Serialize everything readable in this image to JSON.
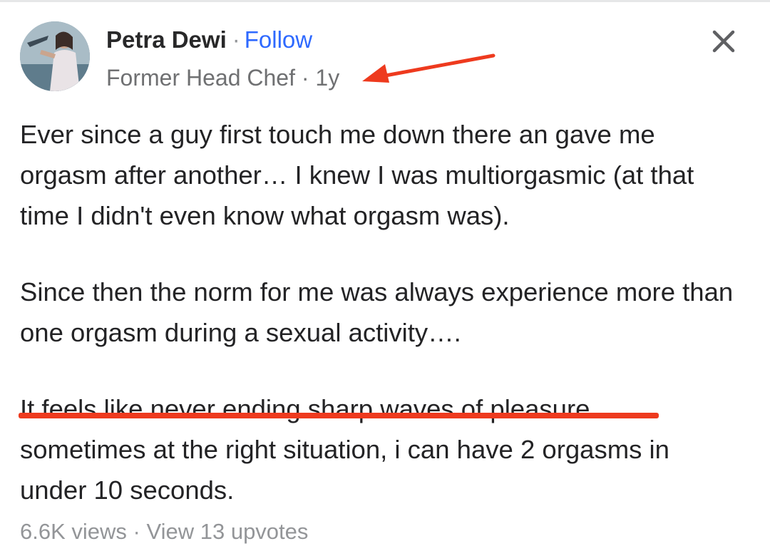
{
  "author": {
    "name": "Petra Dewi",
    "separator": "·",
    "follow_label": "Follow",
    "credential": "Former Head Chef",
    "meta_separator": "·",
    "timestamp": "1y"
  },
  "post": {
    "paragraphs": [
      "Ever since a guy first touch me down there an gave me orgasm after another… I knew I was multiorgasmic (at that time I didn't even know what orgasm was).",
      "Since then the norm for me was always experience more than one orgasm during a sexual activity….",
      "It feels like never ending sharp waves of pleasure… sometimes at the right situation, i can have 2 orgasms in under 10 seconds."
    ]
  },
  "stats": {
    "views": "6.6K views",
    "separator": "·",
    "upvotes_link": "View 13 upvotes"
  },
  "icons": {
    "close": "close-icon",
    "avatar": "avatar-photo"
  },
  "colors": {
    "link_blue": "#2e69ff",
    "annotation_red": "#ee3a1e",
    "muted_text": "#6f7072"
  }
}
